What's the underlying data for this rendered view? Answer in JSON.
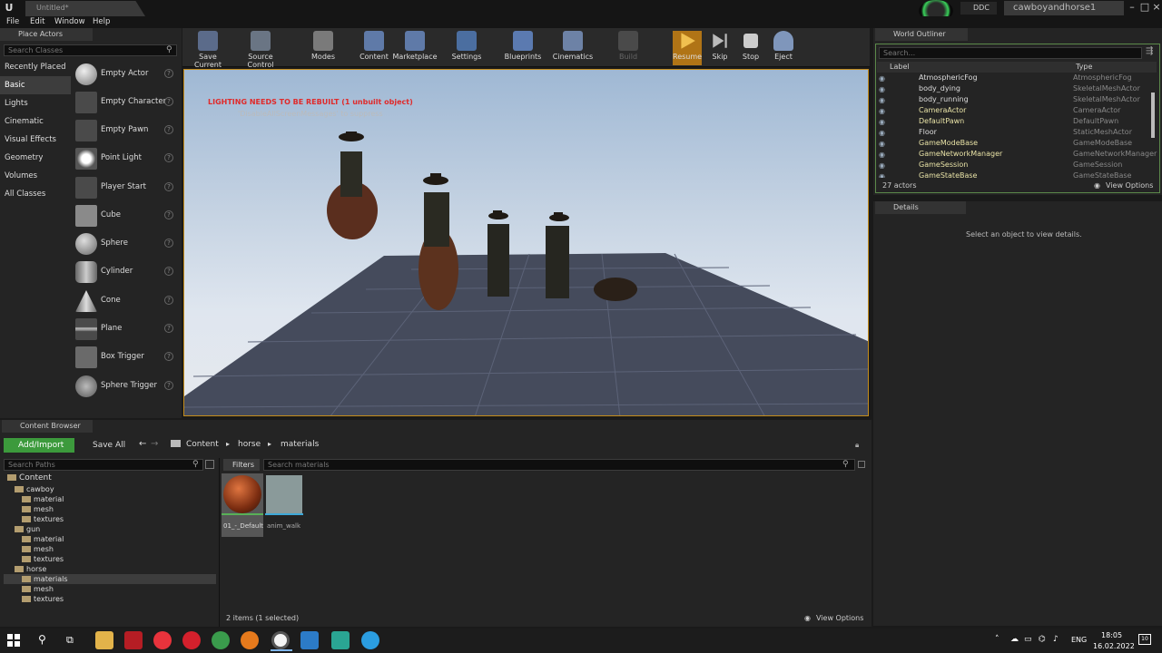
{
  "window": {
    "doc_tab": "Untitled*",
    "ddc": "DDC",
    "project": "cawboyandhorse1"
  },
  "menu": [
    "File",
    "Edit",
    "Window",
    "Help"
  ],
  "place_actors": {
    "tab": "Place Actors",
    "search_placeholder": "Search Classes",
    "categories": [
      "Recently Placed",
      "Basic",
      "Lights",
      "Cinematic",
      "Visual Effects",
      "Geometry",
      "Volumes",
      "All Classes"
    ],
    "selected_category": "Basic",
    "actors": [
      "Empty Actor",
      "Empty Character",
      "Empty Pawn",
      "Point Light",
      "Player Start",
      "Cube",
      "Sphere",
      "Cylinder",
      "Cone",
      "Plane",
      "Box Trigger",
      "Sphere Trigger"
    ]
  },
  "toolbar": {
    "items": [
      {
        "label": "Save Current",
        "icon": "save-icon"
      },
      {
        "label": "Source Control",
        "icon": "source-control-icon"
      },
      {
        "label": "Modes",
        "icon": "modes-icon"
      },
      {
        "label": "Content",
        "icon": "content-icon"
      },
      {
        "label": "Marketplace",
        "icon": "marketplace-icon"
      },
      {
        "label": "Settings",
        "icon": "settings-icon"
      },
      {
        "label": "Blueprints",
        "icon": "blueprints-icon"
      },
      {
        "label": "Cinematics",
        "icon": "cinematics-icon"
      },
      {
        "label": "Build",
        "icon": "build-icon"
      },
      {
        "label": "Resume",
        "icon": "resume-icon"
      },
      {
        "label": "Skip",
        "icon": "skip-icon"
      },
      {
        "label": "Stop",
        "icon": "stop-icon"
      },
      {
        "label": "Eject",
        "icon": "eject-icon"
      }
    ]
  },
  "viewport": {
    "warning": "LIGHTING NEEDS TO BE REBUILT (1 unbuilt object)",
    "suppress": "'DisableAllScreenMessages' to suppress"
  },
  "outliner": {
    "tab": "World Outliner",
    "search_placeholder": "Search...",
    "col_label": "Label",
    "col_type": "Type",
    "rows": [
      {
        "label": "AtmosphericFog",
        "type": "AtmosphericFog"
      },
      {
        "label": "body_dying",
        "type": "SkeletalMeshActor"
      },
      {
        "label": "body_running",
        "type": "SkeletalMeshActor"
      },
      {
        "label": "CameraActor",
        "type": "CameraActor"
      },
      {
        "label": "DefaultPawn",
        "type": "DefaultPawn"
      },
      {
        "label": "Floor",
        "type": "StaticMeshActor"
      },
      {
        "label": "GameModeBase",
        "type": "GameModeBase"
      },
      {
        "label": "GameNetworkManager",
        "type": "GameNetworkManager"
      },
      {
        "label": "GameSession",
        "type": "GameSession"
      },
      {
        "label": "GameStateBase",
        "type": "GameStateBase"
      }
    ],
    "count": "27 actors",
    "view_options": "View Options"
  },
  "details": {
    "tab": "Details",
    "empty": "Select an object to view details."
  },
  "content_browser": {
    "tab": "Content Browser",
    "add_import": "Add/Import",
    "save_all": "Save All",
    "path": [
      "Content",
      "horse",
      "materials"
    ],
    "search_paths": "Search Paths",
    "filters": "Filters",
    "search_assets": "Search materials",
    "tree": [
      {
        "name": "Content",
        "level": 0
      },
      {
        "name": "cawboy",
        "level": 1
      },
      {
        "name": "material",
        "level": 2
      },
      {
        "name": "mesh",
        "level": 2
      },
      {
        "name": "textures",
        "level": 2
      },
      {
        "name": "gun",
        "level": 1
      },
      {
        "name": "material",
        "level": 2
      },
      {
        "name": "mesh",
        "level": 2
      },
      {
        "name": "textures",
        "level": 2
      },
      {
        "name": "horse",
        "level": 1
      },
      {
        "name": "materials",
        "level": 2
      },
      {
        "name": "mesh",
        "level": 2
      },
      {
        "name": "textures",
        "level": 2
      }
    ],
    "assets": [
      "01_-_Default",
      "anim_walk"
    ],
    "status": "2 items (1 selected)",
    "view_options": "View Options"
  },
  "taskbar": {
    "lang": "ENG",
    "time": "18:05",
    "date": "16.02.2022",
    "notif": "10"
  }
}
